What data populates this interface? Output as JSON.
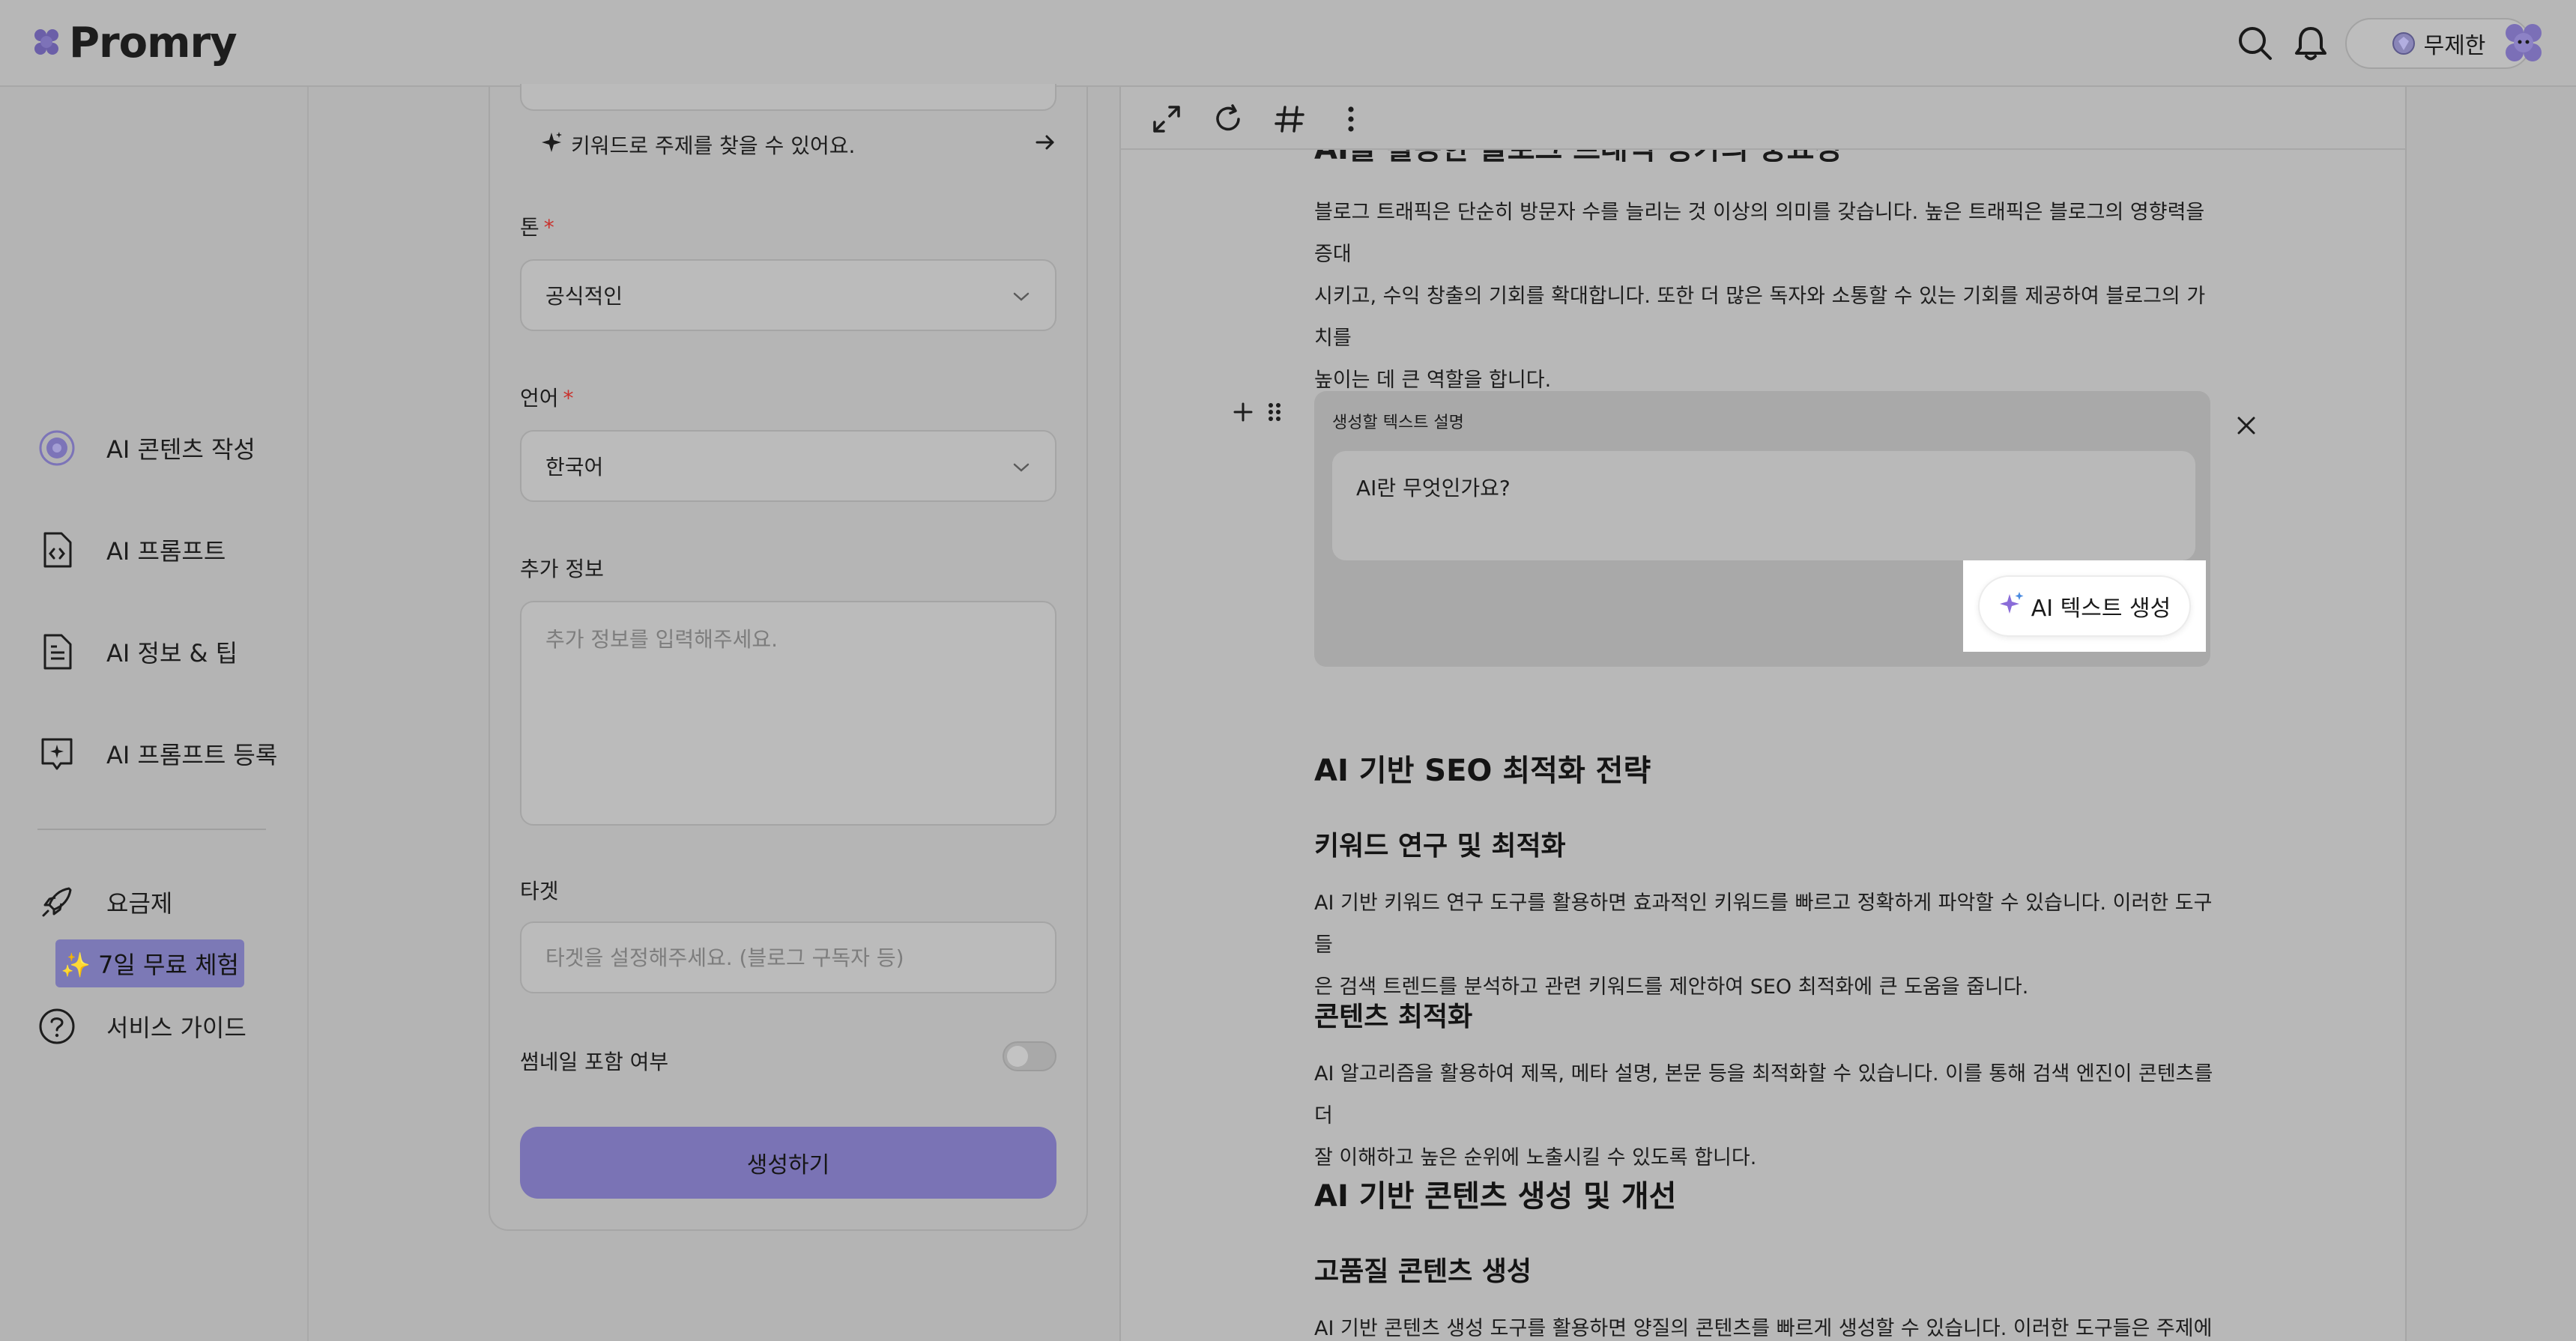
{
  "app": {
    "name": "Promry"
  },
  "header": {
    "plan_label": "무제한"
  },
  "sidebar": {
    "items": [
      {
        "label": "AI 콘텐츠 작성",
        "icon": "ai-content-icon"
      },
      {
        "label": "AI 프롬프트",
        "icon": "code-file-icon"
      },
      {
        "label": "AI 정보 & 팁",
        "icon": "document-icon"
      },
      {
        "label": "AI 프롬프트 등록",
        "icon": "sparkle-chat-icon"
      },
      {
        "label": "요금제",
        "icon": "rocket-icon"
      },
      {
        "label": "서비스 가이드",
        "icon": "help-circle-icon"
      }
    ],
    "trial_badge": "✨ 7일 무료 체험"
  },
  "form": {
    "keyword_hint": "키워드로 주제를 찾을 수 있어요.",
    "tone": {
      "label": "톤",
      "value": "공식적인"
    },
    "language": {
      "label": "언어",
      "value": "한국어"
    },
    "extra": {
      "label": "추가 정보",
      "placeholder": "추가 정보를 입력해주세요."
    },
    "target": {
      "label": "타겟",
      "placeholder": "타겟을 설정해주세요. (블로그 구독자 등)"
    },
    "thumbnail": {
      "label": "썸네일 포함 여부",
      "enabled": false
    },
    "submit_label": "생성하기"
  },
  "editor": {
    "cut_heading": "AI를 활용한 블로그 트래픽 증가의 중요성",
    "intro_lines": [
      "블로그 트래픽은 단순히 방문자 수를 늘리는 것 이상의 의미를 갖습니다. 높은 트래픽은 블로그의 영향력을 증대",
      "시키고, 수익 창출의 기회를 확대합니다. 또한 더 많은 독자와 소통할 수 있는 기회를 제공하여 블로그의 가치를",
      "높이는 데 큰 역할을 합니다."
    ],
    "ai_block": {
      "label": "생성할 텍스트 설명",
      "input_value": "AI란 무엇인가요?",
      "button_label": "AI 텍스트 생성"
    },
    "h2_seo": "AI 기반 SEO 최적화 전략",
    "h3_keyword": "키워드 연구 및 최적화",
    "p_keyword_1": "AI 기반 키워드 연구 도구를 활용하면 효과적인 키워드를 빠르고 정확하게 파악할 수 있습니다. 이러한 도구들",
    "p_keyword_2": "은 검색 트렌드를 분석하고 관련 키워드를 제안하여 SEO 최적화에 큰 도움을 줍니다.",
    "h3_content": "콘텐츠 최적화",
    "p_content_1": "AI 알고리즘을 활용하여 제목, 메타 설명, 본문 등을 최적화할 수 있습니다. 이를 통해 검색 엔진이 콘텐츠를 더",
    "p_content_2": "잘 이해하고 높은 순위에 노출시킬 수 있도록 합니다.",
    "h2_gen": "AI 기반 콘텐츠 생성 및 개선",
    "h3_quality": "고품질 콘텐츠 생성",
    "p_quality_1": "AI 기반 콘텐츠 생성 도구를 활용하면 양질의 콘텐츠를 빠르게 생성할 수 있습니다. 이러한 도구들은 주제에 맞"
  },
  "colors": {
    "accent": "#7a73b5",
    "overlay": "#b4b4b4",
    "highlight": "#ffffff"
  }
}
